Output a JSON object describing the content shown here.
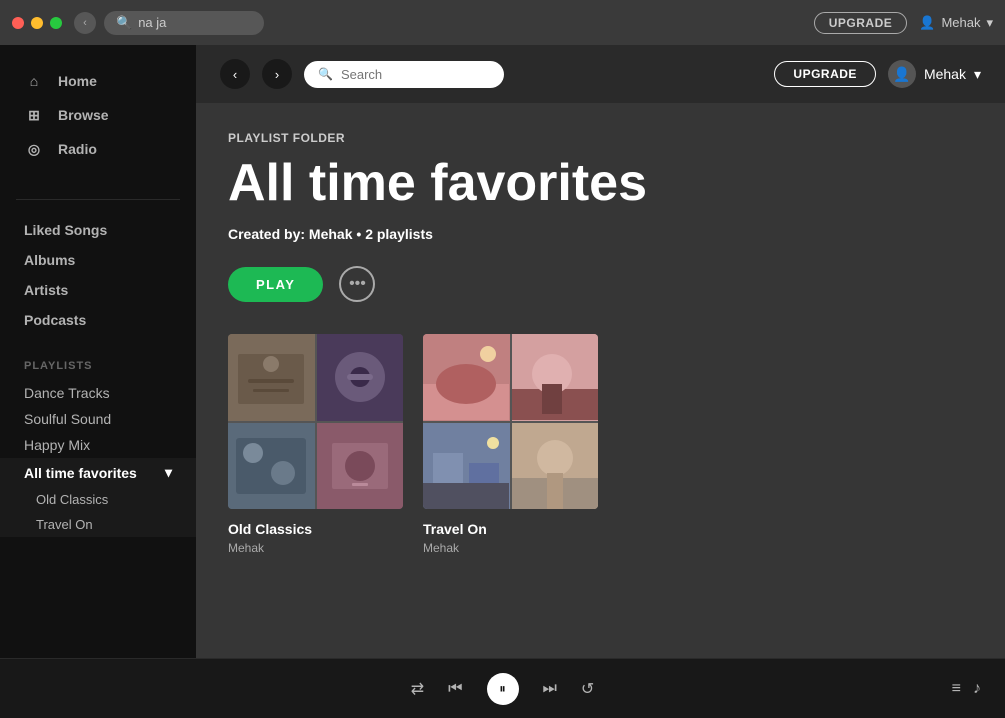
{
  "titlebar": {
    "search_text": "na ja",
    "upgrade_label": "UPGRADE",
    "user_name": "Mehak",
    "back_arrow": "‹",
    "forward_arrow": "›"
  },
  "sidebar": {
    "nav_items": [
      {
        "id": "home",
        "label": "Home",
        "icon": "⌂"
      },
      {
        "id": "browse",
        "label": "Browse",
        "icon": "⊞"
      },
      {
        "id": "radio",
        "label": "Radio",
        "icon": "◎"
      }
    ],
    "library_items": [
      {
        "id": "liked-songs",
        "label": "Liked Songs"
      },
      {
        "id": "albums",
        "label": "Albums"
      },
      {
        "id": "artists",
        "label": "Artists"
      },
      {
        "id": "podcasts",
        "label": "Podcasts"
      }
    ],
    "playlists_label": "PLAYLISTS",
    "playlists": [
      {
        "id": "dance-tracks",
        "label": "Dance Tracks"
      },
      {
        "id": "soulful-sound",
        "label": "Soulful Sound"
      },
      {
        "id": "happy-mix",
        "label": "Happy Mix"
      }
    ],
    "folder": {
      "label": "All time favorites",
      "arrow": "▾",
      "children": [
        {
          "id": "old-classics",
          "label": "Old Classics"
        },
        {
          "id": "travel-on",
          "label": "Travel On"
        }
      ]
    }
  },
  "topbar": {
    "search_placeholder": "Search",
    "upgrade_label": "UPGRADE",
    "user_name": "Mehak",
    "back_arrow": "‹",
    "forward_arrow": "›"
  },
  "content": {
    "folder_tag": "PLAYLIST FOLDER",
    "title": "All time favorites",
    "created_by_label": "Created by:",
    "creator": "Mehak",
    "bullet": "•",
    "playlist_count": "2 playlists",
    "play_label": "PLAY",
    "more_icon": "···",
    "cards": [
      {
        "id": "old-classics",
        "name": "Old Classics",
        "owner": "Mehak",
        "colors": [
          "oc1",
          "oc2",
          "oc3",
          "oc4"
        ]
      },
      {
        "id": "travel-on",
        "name": "Travel On",
        "owner": "Mehak",
        "colors": [
          "to1",
          "to2",
          "to3",
          "to4"
        ]
      }
    ]
  },
  "player": {
    "shuffle_icon": "⇄",
    "prev_icon": "⏮",
    "pause_icon": "⏸",
    "next_icon": "⏭",
    "repeat_icon": "↺",
    "queue_icon": "≡",
    "volume_icon": "♪"
  }
}
